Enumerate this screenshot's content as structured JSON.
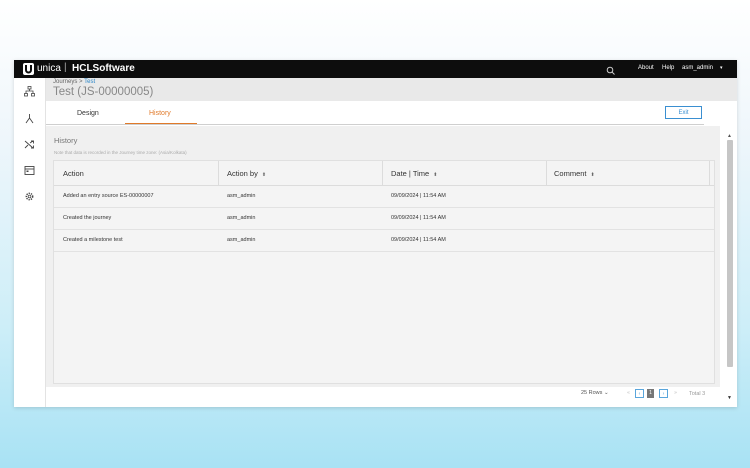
{
  "topbar": {
    "brand": "unica",
    "separator": "|",
    "company": "HCLSoftware",
    "search_icon": "search-icon",
    "links": [
      "About",
      "Help",
      "asm_admin"
    ],
    "user_caret": "▾"
  },
  "leftnav": {
    "icons": [
      "journeys-icon",
      "branch-icon",
      "shuffle-icon",
      "calendar-icon",
      "gear-icon"
    ]
  },
  "header": {
    "breadcrumb_root": "Journeys",
    "breadcrumb_sep": ">",
    "breadcrumb_current": "Test",
    "title": "Test (JS-00000005)"
  },
  "tabs": [
    {
      "label": "Design"
    },
    {
      "label": "History",
      "active": true
    }
  ],
  "exit_label": "Exit",
  "history": {
    "title": "History",
    "note": "Note that data is recorded in the Journey time zone: (Asia/Kolkata)",
    "columns": [
      "Action",
      "Action by",
      "Date | Time",
      "Comment"
    ],
    "rows": [
      {
        "action": "Added an entry source ES-00000007",
        "by": "asm_admin",
        "datetime": "09/09/2024 | 11:54 AM",
        "comment": ""
      },
      {
        "action": "Created the journey",
        "by": "asm_admin",
        "datetime": "09/09/2024 | 11:54 AM",
        "comment": ""
      },
      {
        "action": "Created a milestone test",
        "by": "asm_admin",
        "datetime": "09/09/2024 | 11:54 AM",
        "comment": ""
      }
    ]
  },
  "pagination": {
    "rows_per_page": "25 Rows",
    "current_page": "1",
    "total": "Total 3"
  },
  "colors": {
    "accent_orange": "#e07a2a",
    "accent_blue": "#3a8fd1",
    "topbar": "#0d0d0d"
  }
}
